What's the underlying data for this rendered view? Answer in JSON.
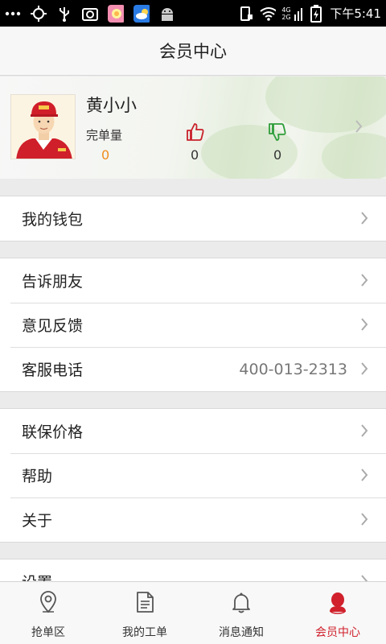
{
  "status_bar": {
    "icons_left": [
      "more-dots-icon",
      "gps-crosshair-icon",
      "usb-icon",
      "screenshot-icon",
      "gallery-app-icon",
      "weather-app-icon",
      "android-icon"
    ],
    "icons_right": [
      "phone-vibrate-icon",
      "wifi-icon",
      "signal-4g-2g-icon",
      "battery-charging-icon"
    ],
    "network_label": "4G 2G",
    "time": "下午5:41"
  },
  "header": {
    "title": "会员中心"
  },
  "profile": {
    "name": "黄小小",
    "completed_orders_label": "完单量",
    "completed_orders": "0",
    "likes": "0",
    "dislikes": "0"
  },
  "menu": {
    "group1": [
      {
        "label": "我的钱包"
      }
    ],
    "group2": [
      {
        "label": "告诉朋友"
      },
      {
        "label": "意见反馈"
      },
      {
        "label": "客服电话",
        "value": "400-013-2313"
      }
    ],
    "group3": [
      {
        "label": "联保价格"
      },
      {
        "label": "帮助"
      },
      {
        "label": "关于"
      }
    ],
    "group4": [
      {
        "label": "设置"
      }
    ]
  },
  "bottom_nav": [
    {
      "label": "抢单区",
      "icon": "location-pin-icon",
      "active": false
    },
    {
      "label": "我的工单",
      "icon": "document-icon",
      "active": false
    },
    {
      "label": "消息通知",
      "icon": "bell-icon",
      "active": false
    },
    {
      "label": "会员中心",
      "icon": "member-icon",
      "active": true
    }
  ],
  "colors": {
    "accent": "#d0212c",
    "orders_value": "#ef8e1d",
    "like": "#c9202a",
    "dislike": "#2e9d3a"
  }
}
